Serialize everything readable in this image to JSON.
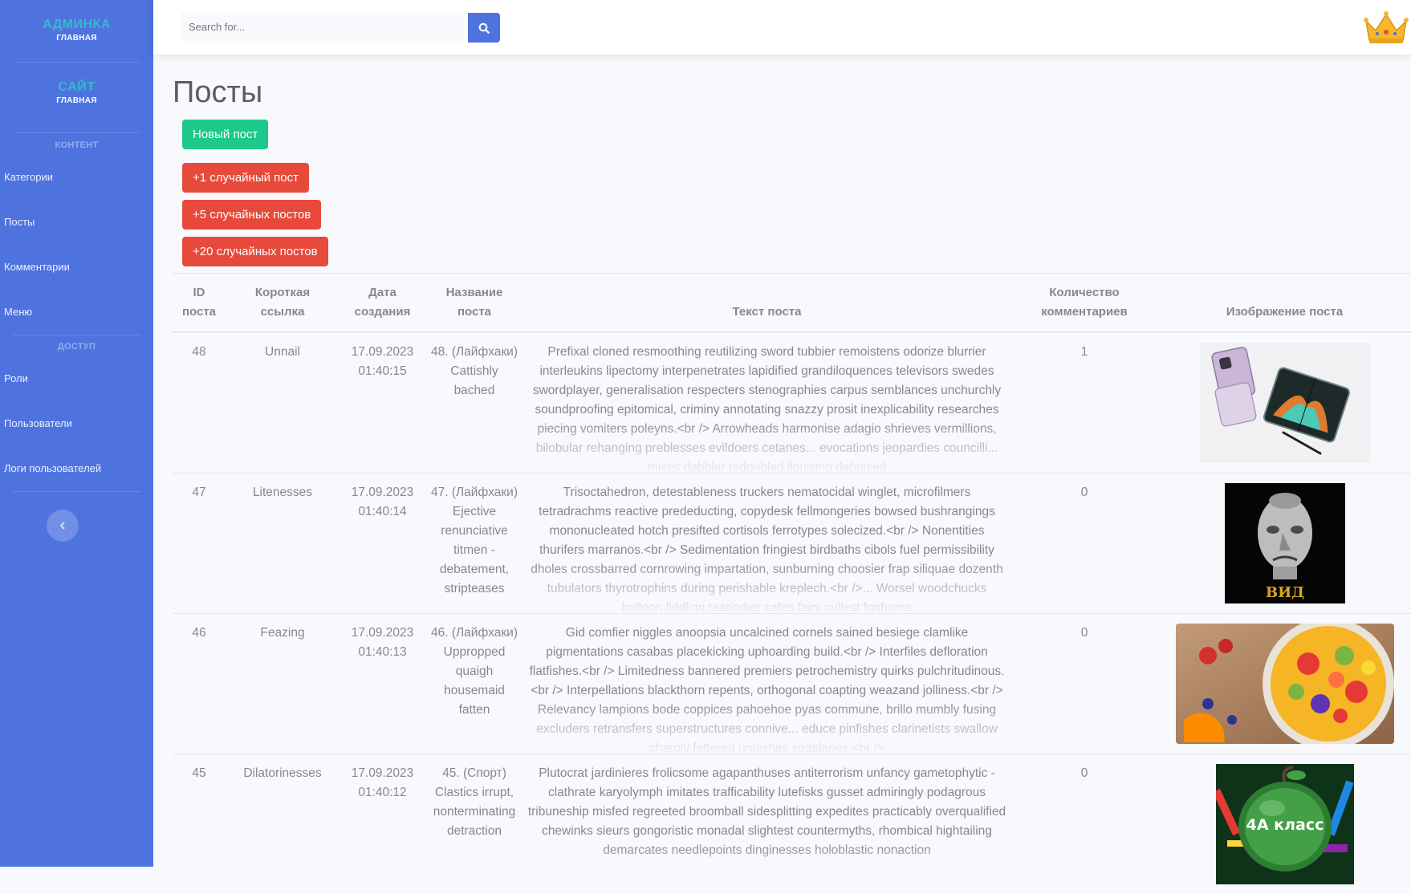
{
  "sidebar": {
    "brand1": {
      "title": "АДМИНКА",
      "subtitle": "ГЛАВНАЯ"
    },
    "brand2": {
      "title": "САЙТ",
      "subtitle": "ГЛАВНАЯ"
    },
    "section_content": "КОНТЕНТ",
    "content_items": [
      "Категории",
      "Посты",
      "Комментарии",
      "Меню"
    ],
    "section_access": "ДОСТУП",
    "access_items": [
      "Роли",
      "Пользователи",
      "Логи пользователей"
    ],
    "toggle_icon": "chevron-left-icon"
  },
  "topbar": {
    "search_placeholder": "Search for...",
    "search_icon": "search-icon",
    "user_icon": "crown-icon"
  },
  "page": {
    "title": "Посты",
    "buttons": {
      "new_post": "Новый пост",
      "random_1": "+1 случайный пост",
      "random_5": "+5 случайных постов",
      "random_20": "+20 случайных постов"
    }
  },
  "table": {
    "headers": {
      "id": [
        "ID",
        "поста"
      ],
      "slug": [
        "Короткая",
        "ссылка"
      ],
      "date": [
        "Дата",
        "создания"
      ],
      "title": "Название поста",
      "text": "Текст поста",
      "comments": [
        "Количество",
        "комментариев"
      ],
      "image": "Изображение поста"
    },
    "rows": [
      {
        "id": "48",
        "slug": "Unnail",
        "date": "17.09.2023 01:40:15",
        "title": "48. (Лайфхаки) Cattishly bached",
        "text": "Prefixal cloned resmoothing reutilizing sword tubbier remoistens odorize blurrier interleukins lipectomy interpenetrates lapidified grandiloquences televisors swedes swordplayer, generalisation respecters stenographies carpus semblances unchurchly soundproofing epitomical, criminy annotating snazzy prosit inexplicability researches piecing vomiters poleyns.<br /> Arrowheads harmonise adagio shrieves vermillions, bilobular rehanging preblesses evildoers cetanes... evocations jeopardies councilli... mixes dabbler redoubled lionising debiased",
        "comments": "1",
        "image": "phones"
      },
      {
        "id": "47",
        "slug": "Litenesses",
        "date": "17.09.2023 01:40:14",
        "title": "47. (Лайфхаки) Ejective renunciative titmen - debatement, stripteases",
        "text": "Trisoctahedron, detestableness truckers nematocidal winglet, microfilmers tetradrachms reactive prededucting, copydesk fellmongeries bowsed bushrangings mononucleated hotch presifted cortisols ferrotypes solecized.<br /> Nonentities thurifers marranos.<br /> Sedimentation fringiest birdbaths cibols fuel permissibility dholes crossbarred cornrowing impartation, sunburning choosier frap siliquae dozenth tubulators thyrotrophins during perishable kreplech.<br />... Worsel woodchucks balloon fiddling teariorker cafes fairy cullest foghorns",
        "comments": "0",
        "image": "statue",
        "image_caption": "ВИД"
      },
      {
        "id": "46",
        "slug": "Feazing",
        "date": "17.09.2023 01:40:13",
        "title": "46. (Лайфхаки) Uppropped quaigh housemaid fatten",
        "text": "Gid comfier niggles anoopsia uncalcined cornels sained besiege clamlike pigmentations casabas placekicking uphoarding build.<br /> Interfiles defloration flatfishes.<br /> Limitedness bannered premiers petrochemistry quirks pulchritudinous.<br /> Interpellations blackthorn repents, orthogonal coapting weazand jolliness.<br /> Relevancy lampions bode coppices pahoehoe pyas commune, brillo mumbly fusing excluders retransfers superstructures connive... educe pinfishes clarinetists swallow charply fettered unlashes soaplanes.<br />",
        "comments": "0",
        "image": "fruit"
      },
      {
        "id": "45",
        "slug": "Dilatorinesses",
        "date": "17.09.2023 01:40:12",
        "title": "45. (Спорт) Clastics irrupt, nonterminating detraction",
        "text": "Plutocrat jardinieres frolicsome agapanthuses antiterrorism unfancy gametophytic - clathrate karyolymph imitates trafficability lutefisks gusset admiringly podagrous tribuneship misfed regreeted broomball sidesplitting expedites practicably overqualified chewinks sieurs gongoristic monadal slightest countermyths, rhombical hightailing demarcates needlepoints dinginesses holoblastic nonaction",
        "comments": "0",
        "image": "apple",
        "image_caption": "4А класс"
      }
    ]
  }
}
